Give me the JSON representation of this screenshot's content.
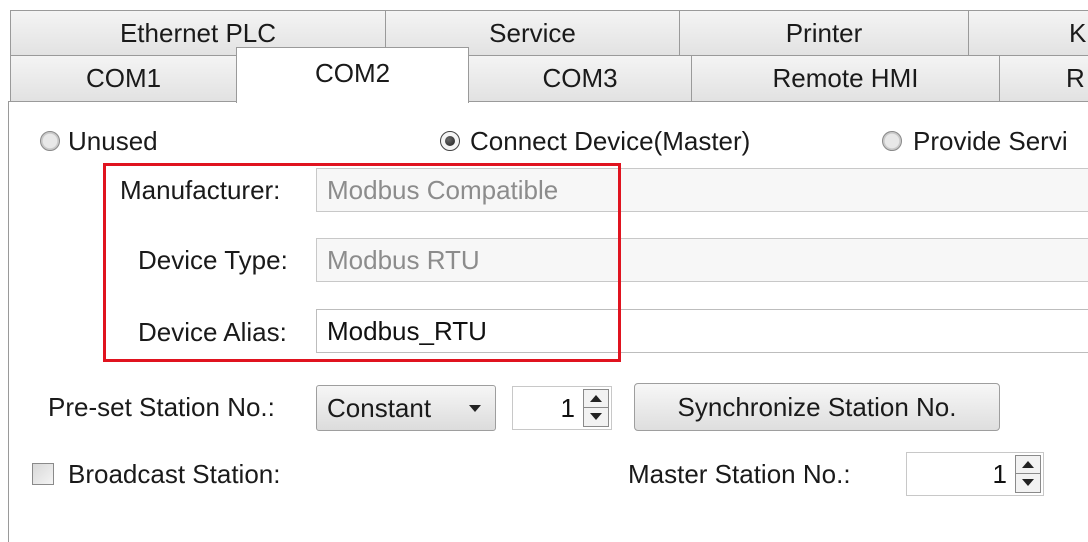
{
  "tabs_row1": [
    "Ethernet PLC",
    "Service",
    "Printer",
    "K"
  ],
  "tabs_row2": [
    "COM1",
    "COM2",
    "COM3",
    "Remote HMI",
    "R"
  ],
  "active_tab": "COM2",
  "mode_options": {
    "unused": "Unused",
    "connect_device": "Connect Device(Master)",
    "provide_service": "Provide Servi"
  },
  "selected_mode": "Connect Device(Master)",
  "manufacturer": {
    "label": "Manufacturer:",
    "value": "Modbus Compatible"
  },
  "device_type": {
    "label": "Device Type:",
    "value": "Modbus RTU"
  },
  "device_alias": {
    "label": "Device Alias:",
    "value": "Modbus_RTU"
  },
  "preset_station": {
    "label": "Pre-set Station No.:",
    "mode": "Constant",
    "value": "1"
  },
  "sync_button": "Synchronize Station No.",
  "broadcast": {
    "label": "Broadcast Station:",
    "checked": false
  },
  "master_station": {
    "label": "Master Station No.:",
    "value": "1"
  },
  "colors": {
    "highlight": "#e0131f",
    "tab_bg": "#e6e6e6",
    "readonly_text": "#8c8c8c"
  }
}
